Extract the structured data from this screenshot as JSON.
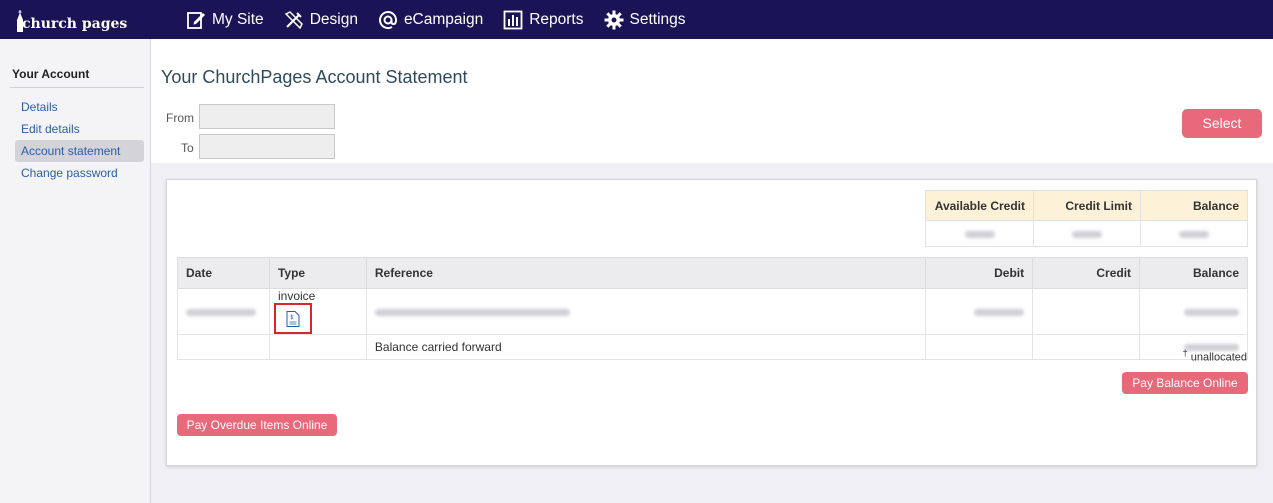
{
  "brand": {
    "logo_text": "church pages"
  },
  "nav": {
    "items": [
      {
        "label": "My Site",
        "icon": "edit-icon"
      },
      {
        "label": "Design",
        "icon": "design-tools-icon"
      },
      {
        "label": "eCampaign",
        "icon": "at-sign-icon"
      },
      {
        "label": "Reports",
        "icon": "bar-chart-icon"
      },
      {
        "label": "Settings",
        "icon": "gear-icon"
      }
    ]
  },
  "sidebar": {
    "heading": "Your Account",
    "items": [
      {
        "label": "Details"
      },
      {
        "label": "Edit details"
      },
      {
        "label": "Account statement",
        "active": true
      },
      {
        "label": "Change password"
      }
    ]
  },
  "main": {
    "title": "Your ChurchPages Account Statement",
    "from_label": "From",
    "to_label": "To",
    "from_value": "",
    "to_value": "",
    "select_label": "Select"
  },
  "summary": {
    "headers": [
      "Available Credit",
      "Credit Limit",
      "Balance"
    ]
  },
  "statement": {
    "headers": [
      "Date",
      "Type",
      "Reference",
      "Debit",
      "Credit",
      "Balance"
    ],
    "row1_type": "invoice",
    "row2_reference": "Balance carried forward"
  },
  "footer": {
    "dagger": "†",
    "unallocated": "unallocated",
    "pay_balance_label": "Pay Balance Online",
    "pay_overdue_label": "Pay Overdue Items Online"
  },
  "colors": {
    "nav_bg": "#1a1456",
    "accent": "#e8697a",
    "highlight": "#d8262a",
    "summary_header": "#fdf1d8"
  }
}
